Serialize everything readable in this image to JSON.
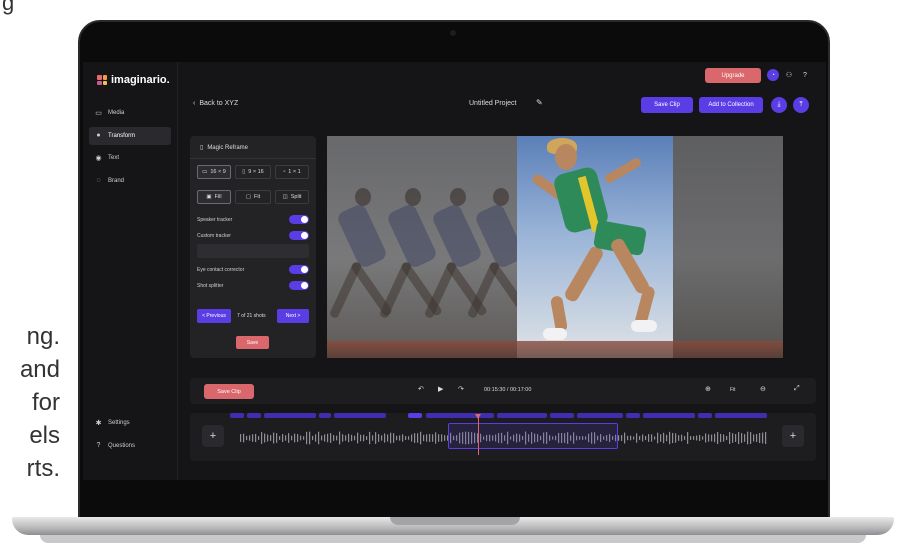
{
  "background_text": {
    "top_fragment": "g",
    "lines": [
      "ng.",
      "and",
      "for",
      "els",
      "rts."
    ]
  },
  "app": {
    "brand": "imaginario.",
    "nav": [
      {
        "label": "Media",
        "icon": "media-icon"
      },
      {
        "label": "Transform",
        "icon": "transform-icon",
        "active": true
      },
      {
        "label": "Text",
        "icon": "text-icon"
      },
      {
        "label": "Brand",
        "icon": "brand-icon"
      }
    ],
    "nav_bottom": [
      {
        "label": "Settings",
        "icon": "gear-icon"
      },
      {
        "label": "Questions",
        "icon": "help-icon"
      }
    ],
    "topbar": {
      "upgrade_label": "Upgrade"
    },
    "header": {
      "back_label": "Back to XYZ",
      "project_title": "Untitled Project",
      "save_clip_label": "Save Clip",
      "add_collection_label": "Add to Collection"
    },
    "panel": {
      "title": "Magic Reframe",
      "ratios": [
        "16 × 9",
        "9 × 16",
        "1 × 1"
      ],
      "fit_modes": [
        "Fill",
        "Fit",
        "Split"
      ],
      "toggles": [
        {
          "label": "Speaker tracker",
          "on": true
        },
        {
          "label": "Custom tracker",
          "on": true
        },
        {
          "label": "Eye contact corrector",
          "on": true
        },
        {
          "label": "Shot splitter",
          "on": true
        }
      ],
      "previous_label": "< Previous",
      "pager_text": "7 of 21 shots",
      "next_label": "Next >",
      "save_label": "Save"
    },
    "transport": {
      "save_clip_label": "Save Clip",
      "timecode": "00:15:30 / 00:17:00",
      "zoom_label": "Fit"
    },
    "colors": {
      "accent": "#5b3de6",
      "coral": "#d9676b",
      "bg": "#151517"
    }
  }
}
